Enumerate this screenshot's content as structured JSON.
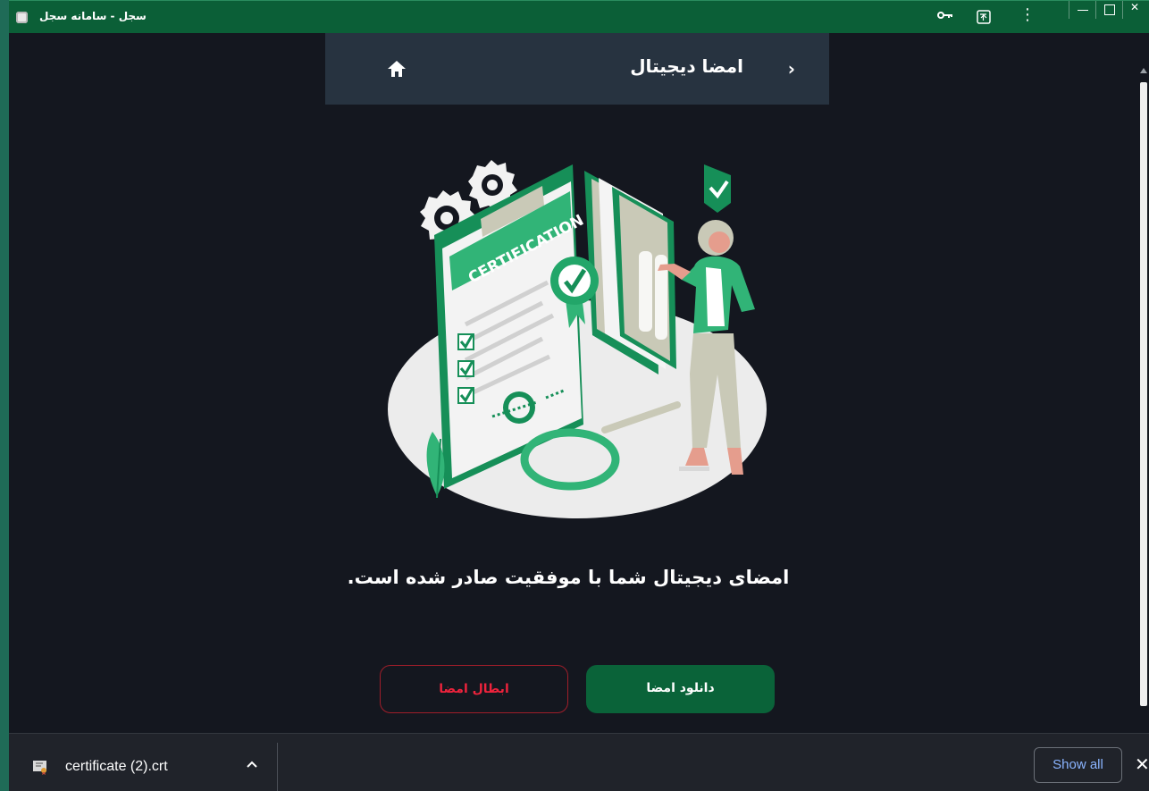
{
  "window": {
    "title": "سجل - سامانه سجل"
  },
  "header": {
    "title": "امضا دیجیتال"
  },
  "illustration": {
    "label": "CERTIFICATION"
  },
  "content": {
    "success_message": "امضای دیجیتال شما با موفقیت صادر شده است."
  },
  "actions": {
    "download_label": "دانلود امضا",
    "revoke_label": "ابطال امضا"
  },
  "downloads": {
    "file_name": "certificate (2).crt",
    "show_all_label": "Show all"
  },
  "icons": {
    "window": "app-icon",
    "password": "key-icon",
    "translate": "translate-icon",
    "menu": "menu-icon",
    "home": "home-icon",
    "back": "chevron-right-icon",
    "file": "certificate-file-icon",
    "expand": "chevron-up-icon",
    "close": "close-icon"
  },
  "colors": {
    "titlebar": "#0b5f37",
    "page": "#14171f",
    "header_card": "#273340",
    "primary_button": "#0a6339",
    "danger": "#ef233c",
    "link": "#8ab4ff"
  }
}
